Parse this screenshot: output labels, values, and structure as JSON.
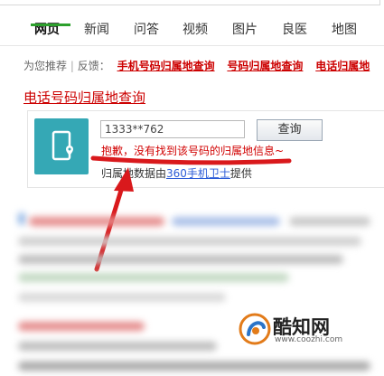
{
  "nav": {
    "tabs": [
      {
        "label": "网页",
        "active": true
      },
      {
        "label": "新闻"
      },
      {
        "label": "问答"
      },
      {
        "label": "视频"
      },
      {
        "label": "图片"
      },
      {
        "label": "良医"
      },
      {
        "label": "地图"
      }
    ]
  },
  "recommend": {
    "prefix": "为您推荐",
    "feedback": "反馈：",
    "links": [
      "手机号码归属地查询",
      "号码归属地查询",
      "电话归属地"
    ]
  },
  "result": {
    "title": "电话号码归属地查询",
    "input_value": "1333**762",
    "button_label": "查询",
    "error_message": "抱歉，没有找到该号码的归属地信息~",
    "source_prefix": "归属地数据由",
    "source_link": "360手机卫士",
    "source_suffix": "提供"
  },
  "watermark": {
    "name": "酷知网",
    "url": "www.coozhi.com"
  },
  "colors": {
    "accent_green": "#2ca02c",
    "link_red": "#c00",
    "tile_teal": "#35a8b5",
    "annotation_red": "#d9191c"
  },
  "icons": {
    "phone_location": "phone-location-icon",
    "watermark_logo": "coozhi-logo-icon"
  }
}
